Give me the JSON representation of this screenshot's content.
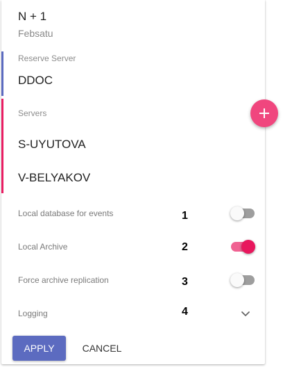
{
  "header": {
    "title": "N + 1",
    "subtitle": "Febsatu"
  },
  "reserve": {
    "label": "Reserve Server",
    "server": "DDOC",
    "accent": "#5c6bc0"
  },
  "servers": {
    "label": "Servers",
    "items": [
      "S-UYUTOVA",
      "V-BELYAKOV"
    ],
    "accent": "#e91e63"
  },
  "add_button": {
    "icon": "plus-icon",
    "color": "#f0467e"
  },
  "settings": [
    {
      "label": "Local database for events",
      "marker": "1",
      "control": "toggle",
      "on": false
    },
    {
      "label": "Local Archive",
      "marker": "2",
      "control": "toggle",
      "on": true
    },
    {
      "label": "Force archive replication",
      "marker": "3",
      "control": "toggle",
      "on": false
    },
    {
      "label": "Logging",
      "marker": "4",
      "control": "expand",
      "icon": "chevron-down-icon"
    }
  ],
  "toggle_colors": {
    "on_track": "#f06292",
    "on_thumb": "#e8175d",
    "off_track": "#9e9e9e",
    "off_thumb": "#fafafa"
  },
  "actions": {
    "apply_label": "APPLY",
    "cancel_label": "CANCEL",
    "apply_color": "#5c6bc0"
  }
}
